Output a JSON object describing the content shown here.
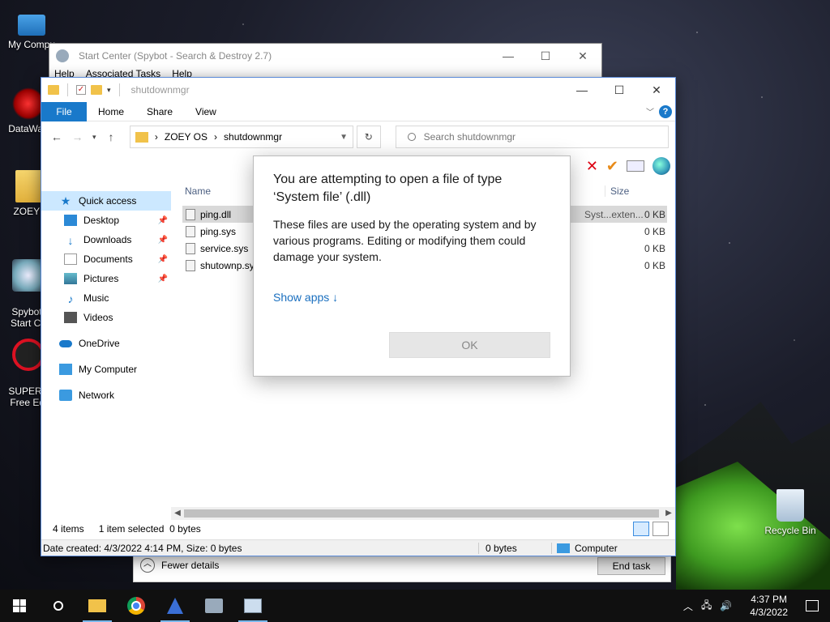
{
  "desktop": {
    "icons": [
      {
        "label": "My Compu",
        "icon": "computer-icon"
      },
      {
        "label": "DataWag",
        "icon": "datawag-icon"
      },
      {
        "label": "ZOEY O",
        "icon": "folder-icon"
      },
      {
        "label": "Spybot-\nStart Ce",
        "icon": "spybot-icon"
      },
      {
        "label": "SUPERA\nFree Edi",
        "icon": "superantispyware-icon"
      },
      {
        "label": "Recycle Bin",
        "icon": "recycle-bin-icon"
      }
    ]
  },
  "spybot_window": {
    "title": "Start Center (Spybot - Search & Destroy 2.7)",
    "menu": [
      "Help",
      "Associated Tasks",
      "Help"
    ]
  },
  "task_manager": {
    "fewer_details": "Fewer details",
    "end_task": "End task"
  },
  "explorer": {
    "title": "shutdownmgr",
    "ribbon_tabs": {
      "file": "File",
      "home": "Home",
      "share": "Share",
      "view": "View"
    },
    "address": {
      "root": "ZOEY OS",
      "current": "shutdownmgr"
    },
    "search_placeholder": "Search shutdownmgr",
    "nav": {
      "quick_access": "Quick access",
      "desktop": "Desktop",
      "downloads": "Downloads",
      "documents": "Documents",
      "pictures": "Pictures",
      "music": "Music",
      "videos": "Videos",
      "onedrive": "OneDrive",
      "my_computer": "My Computer",
      "network": "Network"
    },
    "columns": {
      "name": "Name",
      "size": "Size"
    },
    "files": [
      {
        "name": "ping.dll",
        "type": "Syst...exten...",
        "size": "0 KB",
        "selected": true
      },
      {
        "name": "ping.sys",
        "type": "",
        "size": "0 KB",
        "selected": false
      },
      {
        "name": "service.sys",
        "type": "",
        "size": "0 KB",
        "selected": false
      },
      {
        "name": "shutownp.sys",
        "type": "",
        "size": "0 KB",
        "selected": false
      }
    ],
    "status": {
      "items": "4 items",
      "selected": "1 item selected",
      "bytes": "0 bytes"
    },
    "details": {
      "created": "Date created: 4/3/2022 4:14 PM, Size: 0 bytes",
      "bytes": "0 bytes",
      "location": "Computer"
    }
  },
  "dialog": {
    "title": "You are attempting to open a file of type ‘System file’ (.dll)",
    "body": "These files are used by the operating system and by various programs. Editing or modifying them could damage your system.",
    "show_apps": "Show apps ↓",
    "ok": "OK"
  },
  "taskbar": {
    "time": "4:37 PM",
    "date": "4/3/2022"
  },
  "colors": {
    "accent": "#1979ca",
    "selection": "#cce8ff",
    "taskbar": "#101010"
  }
}
